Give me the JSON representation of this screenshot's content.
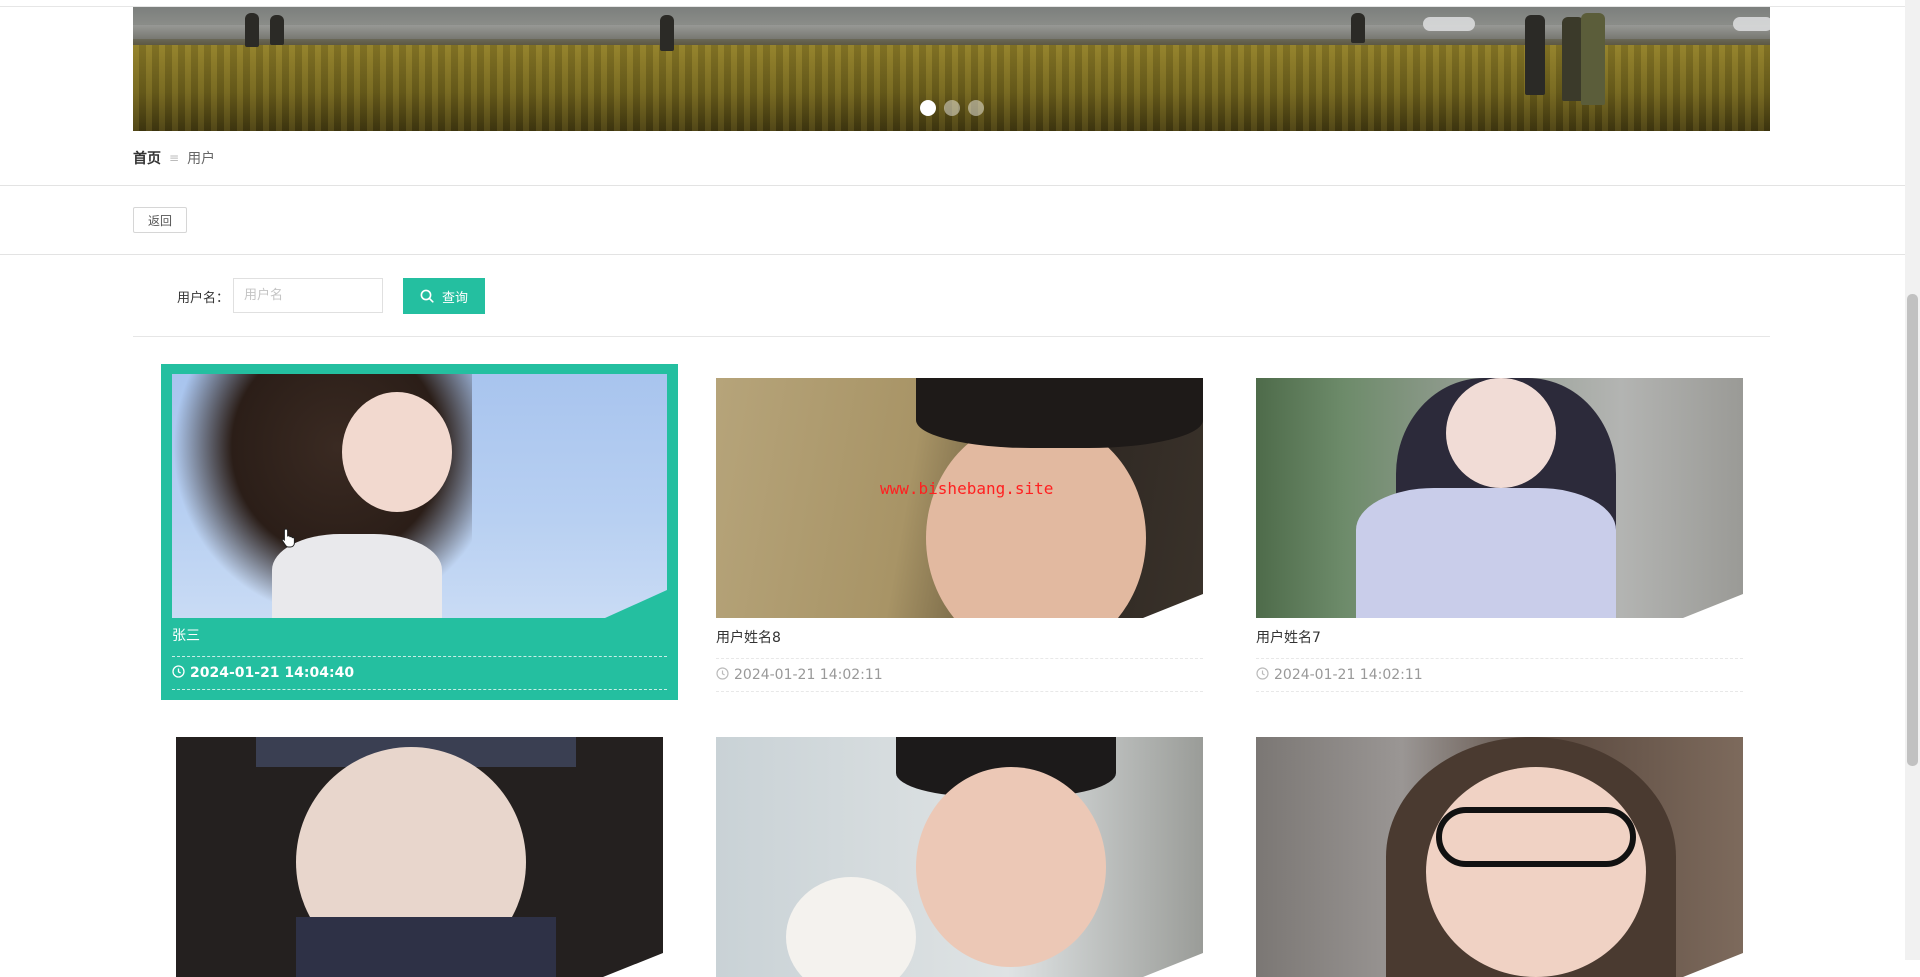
{
  "banner": {
    "slides": 3,
    "active_slide": 1
  },
  "breadcrumb": {
    "home": "首页",
    "separator": "≡",
    "current": "用户"
  },
  "back_button": "返回",
  "search": {
    "label": "用户名：",
    "placeholder": "用户名",
    "button": "查询"
  },
  "watermark": "www.bishebang.site",
  "colors": {
    "accent": "#24bfa0"
  },
  "cards": [
    {
      "name": "张三",
      "time": "2024-01-21 14:04:40",
      "active": true
    },
    {
      "name": "用户姓名8",
      "time": "2024-01-21 14:02:11"
    },
    {
      "name": "用户姓名7",
      "time": "2024-01-21 14:02:11"
    },
    {
      "name": "",
      "time": ""
    },
    {
      "name": "",
      "time": ""
    },
    {
      "name": "",
      "time": ""
    }
  ]
}
